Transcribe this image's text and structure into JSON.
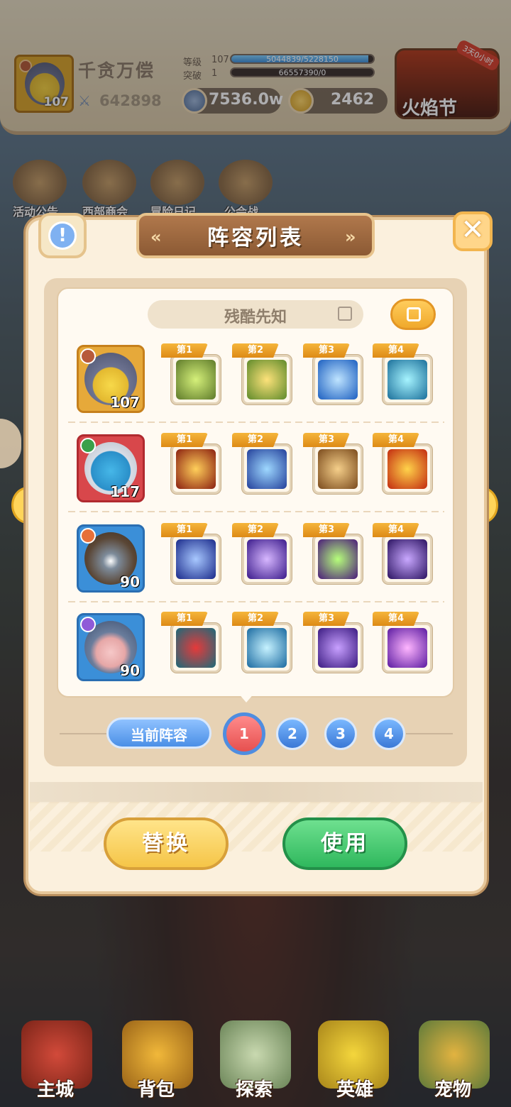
{
  "header": {
    "player_name": "千贪万偿",
    "hero_level": "107",
    "power": "642898",
    "level_label": "等级",
    "level_value": "107",
    "exp_text": "5044839/5228150",
    "exp_fraction": 0.965,
    "breakthrough_label": "突破",
    "breakthrough_value": "1",
    "breakthrough_text": "66557390/0",
    "breakthrough_fraction": 0.0,
    "gold": "7536.0w",
    "gems": "2462",
    "event_label": "火焰节",
    "event_tag": "3天0小时"
  },
  "menu": [
    {
      "label": "活动公告",
      "icon": "announcement-icon"
    },
    {
      "label": "西部商会",
      "icon": "merchant-icon"
    },
    {
      "label": "冒险日记",
      "icon": "diary-icon"
    },
    {
      "label": "公会战",
      "icon": "guild-war-icon"
    }
  ],
  "panel": {
    "title": "阵容列表",
    "lineup_name": "残酷先知",
    "current_team_label": "当前阵容",
    "pages": [
      "1",
      "2",
      "3",
      "4"
    ],
    "active_page": 1,
    "replace_label": "替换",
    "use_label": "使用"
  },
  "lineup": [
    {
      "level": "107",
      "portrait": "knight-duck",
      "skills": [
        {
          "tag": "第1",
          "icon": "arrow-strike-icon"
        },
        {
          "tag": "第2",
          "icon": "shield-star-icon"
        },
        {
          "tag": "第3",
          "icon": "ice-wing-icon"
        },
        {
          "tag": "第4",
          "icon": "hammer-icon"
        }
      ]
    },
    {
      "level": "117",
      "portrait": "blue-bird",
      "skills": [
        {
          "tag": "第1",
          "icon": "fire-eye-icon"
        },
        {
          "tag": "第2",
          "icon": "water-spirit-icon"
        },
        {
          "tag": "第3",
          "icon": "ghost-hand-icon"
        },
        {
          "tag": "第4",
          "icon": "flame-dragon-icon"
        }
      ]
    },
    {
      "level": "90",
      "portrait": "tree-hood",
      "skills": [
        {
          "tag": "第1",
          "icon": "blue-slash-icon"
        },
        {
          "tag": "第2",
          "icon": "purple-rain-icon"
        },
        {
          "tag": "第3",
          "icon": "poison-burst-icon"
        },
        {
          "tag": "第4",
          "icon": "shadow-swirl-icon"
        }
      ]
    },
    {
      "level": "90",
      "portrait": "armored-pig",
      "skills": [
        {
          "tag": "第1",
          "icon": "red-mask-icon"
        },
        {
          "tag": "第2",
          "icon": "ice-trident-icon"
        },
        {
          "tag": "第3",
          "icon": "vortex-icon"
        },
        {
          "tag": "第4",
          "icon": "star-burst-icon"
        }
      ]
    }
  ],
  "bottom_nav": [
    {
      "label": "主城",
      "icon": "castle-icon"
    },
    {
      "label": "背包",
      "icon": "backpack-icon"
    },
    {
      "label": "探索",
      "icon": "map-icon"
    },
    {
      "label": "英雄",
      "icon": "hero-icon"
    },
    {
      "label": "宠物",
      "icon": "pet-icon"
    }
  ],
  "colors": {
    "accent": "#f0a92b",
    "primary_blue": "#4b8fe6",
    "use_green": "#2fb85d",
    "panel_bg": "#fbf0dd"
  }
}
